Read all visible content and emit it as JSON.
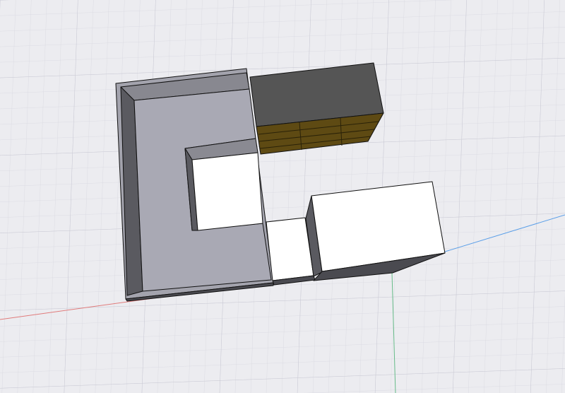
{
  "viewport": {
    "background": "#ececf0",
    "grid_minor_color": "#d6d6df",
    "grid_major_color": "#c6c6d2",
    "axis_x_color": "#e07b7b",
    "axis_y_color": "#66bb88",
    "axis_z_color": "#5b9fe8"
  },
  "objects": [
    {
      "name": "c-shaped-counter",
      "color": "#a7a7b0",
      "icon": "none"
    },
    {
      "name": "dark-cabinet",
      "top_color": "#555555",
      "front_color": "#5e4a13"
    },
    {
      "name": "small-white-box",
      "color": "#ffffff"
    },
    {
      "name": "large-white-box",
      "color": "#ffffff"
    }
  ]
}
